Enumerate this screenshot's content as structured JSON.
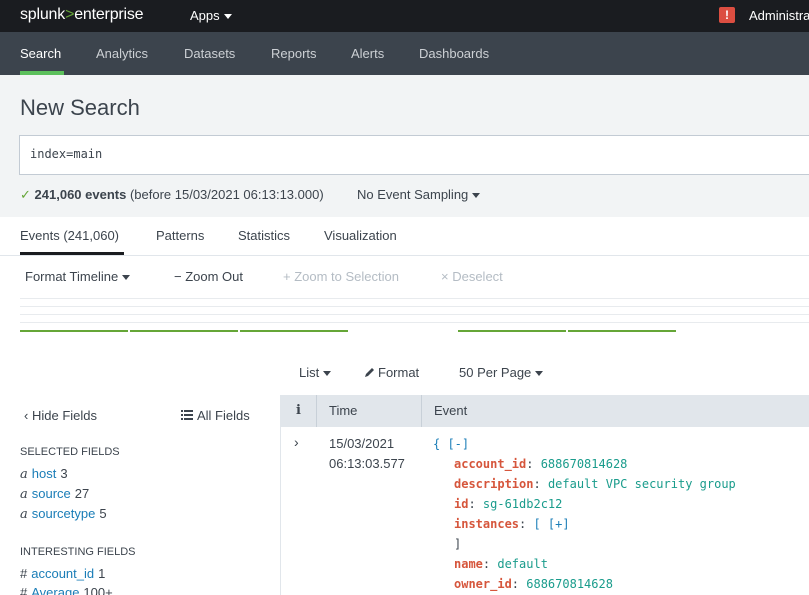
{
  "topbar": {
    "logo_brand": "splunk",
    "logo_gt": ">",
    "logo_product": "enterprise",
    "apps_label": "Apps",
    "alert_glyph": "!",
    "user_label": "Administra"
  },
  "nav": {
    "items": [
      "Search",
      "Analytics",
      "Datasets",
      "Reports",
      "Alerts",
      "Dashboards"
    ],
    "active": "Search"
  },
  "search": {
    "title": "New Search",
    "query": "index=main",
    "status_check": "✓",
    "event_count": "241,060 events",
    "status_detail": "(before 15/03/2021 06:13:13.000)",
    "sampling_label": "No Event Sampling"
  },
  "tabs": [
    "Events (241,060)",
    "Patterns",
    "Statistics",
    "Visualization"
  ],
  "timeline": {
    "format_label": "Format Timeline",
    "zoom_out": "− Zoom Out",
    "zoom_selection": "+ Zoom to Selection",
    "deselect": "× Deselect"
  },
  "list_controls": {
    "list_label": "List",
    "format_label": "Format",
    "per_page_label": "50 Per Page"
  },
  "fields": {
    "hide_label": "Hide Fields",
    "all_label": "All Fields",
    "selected_title": "SELECTED FIELDS",
    "selected": [
      {
        "type": "a",
        "name": "host",
        "count": "3"
      },
      {
        "type": "a",
        "name": "source",
        "count": "27"
      },
      {
        "type": "a",
        "name": "sourcetype",
        "count": "5"
      }
    ],
    "interesting_title": "INTERESTING FIELDS",
    "interesting": [
      {
        "type": "#",
        "name": "account_id",
        "count": "1"
      },
      {
        "type": "#",
        "name": "Average",
        "count": "100+"
      }
    ]
  },
  "table": {
    "col_info": "i",
    "col_time": "Time",
    "col_event": "Event",
    "row": {
      "expand_glyph": "›",
      "date": "15/03/2021",
      "time": "06:13:03.577",
      "open_brace": "{ [-]",
      "fields": [
        {
          "key": "account_id",
          "value": "688670814628"
        },
        {
          "key": "description",
          "value": "default VPC security group"
        },
        {
          "key": "id",
          "value": "sg-61db2c12"
        },
        {
          "key": "instances",
          "value": "[ [+]"
        },
        {
          "key": "",
          "value": "]"
        },
        {
          "key": "name",
          "value": "default"
        },
        {
          "key": "owner_id",
          "value": "688670814628"
        }
      ]
    }
  },
  "colors": {
    "accent_green": "#65a637",
    "nav_bg": "#3c444d",
    "topbar_bg": "#1a1c20",
    "alert_red": "#dc4e41",
    "link_blue": "#1a7db7"
  }
}
